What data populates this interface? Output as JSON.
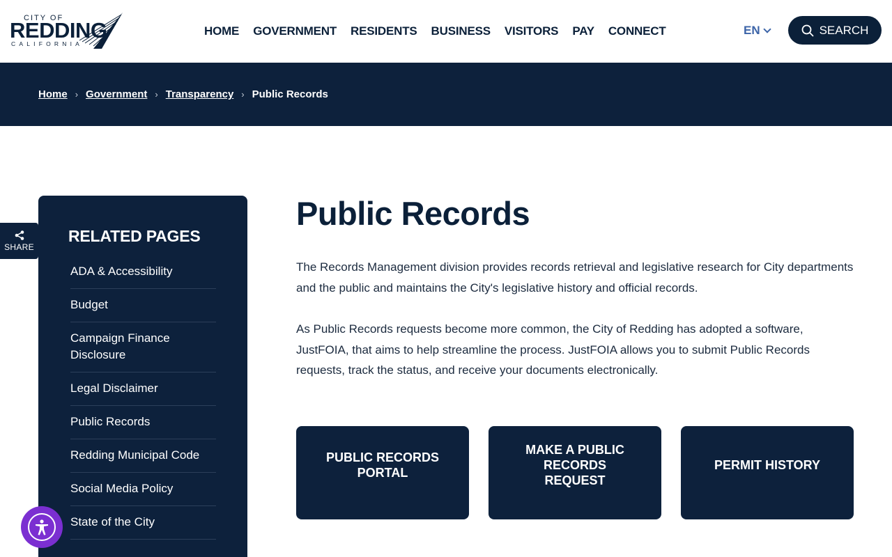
{
  "header": {
    "logo": {
      "top": "CITY OF",
      "main": "REDDING",
      "bottom": "CALIFORNIA"
    },
    "nav": [
      {
        "label": "HOME"
      },
      {
        "label": "GOVERNMENT"
      },
      {
        "label": "RESIDENTS"
      },
      {
        "label": "BUSINESS"
      },
      {
        "label": "VISITORS"
      },
      {
        "label": "PAY"
      },
      {
        "label": "CONNECT"
      }
    ],
    "language": "EN",
    "search_label": "SEARCH"
  },
  "breadcrumb": [
    {
      "label": "Home"
    },
    {
      "label": "Government"
    },
    {
      "label": "Transparency"
    },
    {
      "label": "Public Records"
    }
  ],
  "share": {
    "label": "SHARE",
    "icon": "share-icon"
  },
  "sidebar": {
    "title": "RELATED PAGES",
    "items": [
      {
        "label": "ADA & Accessibility"
      },
      {
        "label": "Budget"
      },
      {
        "label": "Campaign Finance Disclosure"
      },
      {
        "label": "Legal Disclaimer"
      },
      {
        "label": "Public Records"
      },
      {
        "label": "Redding Municipal Code"
      },
      {
        "label": "Social Media Policy"
      },
      {
        "label": "State of the City"
      }
    ]
  },
  "main": {
    "title": "Public Records",
    "paragraphs": [
      "The Records Management division provides records retrieval and legislative research for City departments and the public and maintains the City's legislative history and official records.",
      "As Public Records requests become more common, the City of Redding has adopted a software, JustFOIA, that aims to help streamline the process. JustFOIA allows you to submit Public Records requests, track the status, and receive your documents electronically."
    ],
    "cards": [
      {
        "label": "PUBLIC RECORDS PORTAL"
      },
      {
        "label": "MAKE A PUBLIC RECORDS REQUEST"
      },
      {
        "label": "PERMIT HISTORY"
      }
    ]
  },
  "colors": {
    "navy": "#0d213c",
    "accent_blue": "#3c64a8",
    "accessibility_purple": "#7b2fd1"
  },
  "accessibility_button": {
    "icon": "accessibility-icon"
  }
}
